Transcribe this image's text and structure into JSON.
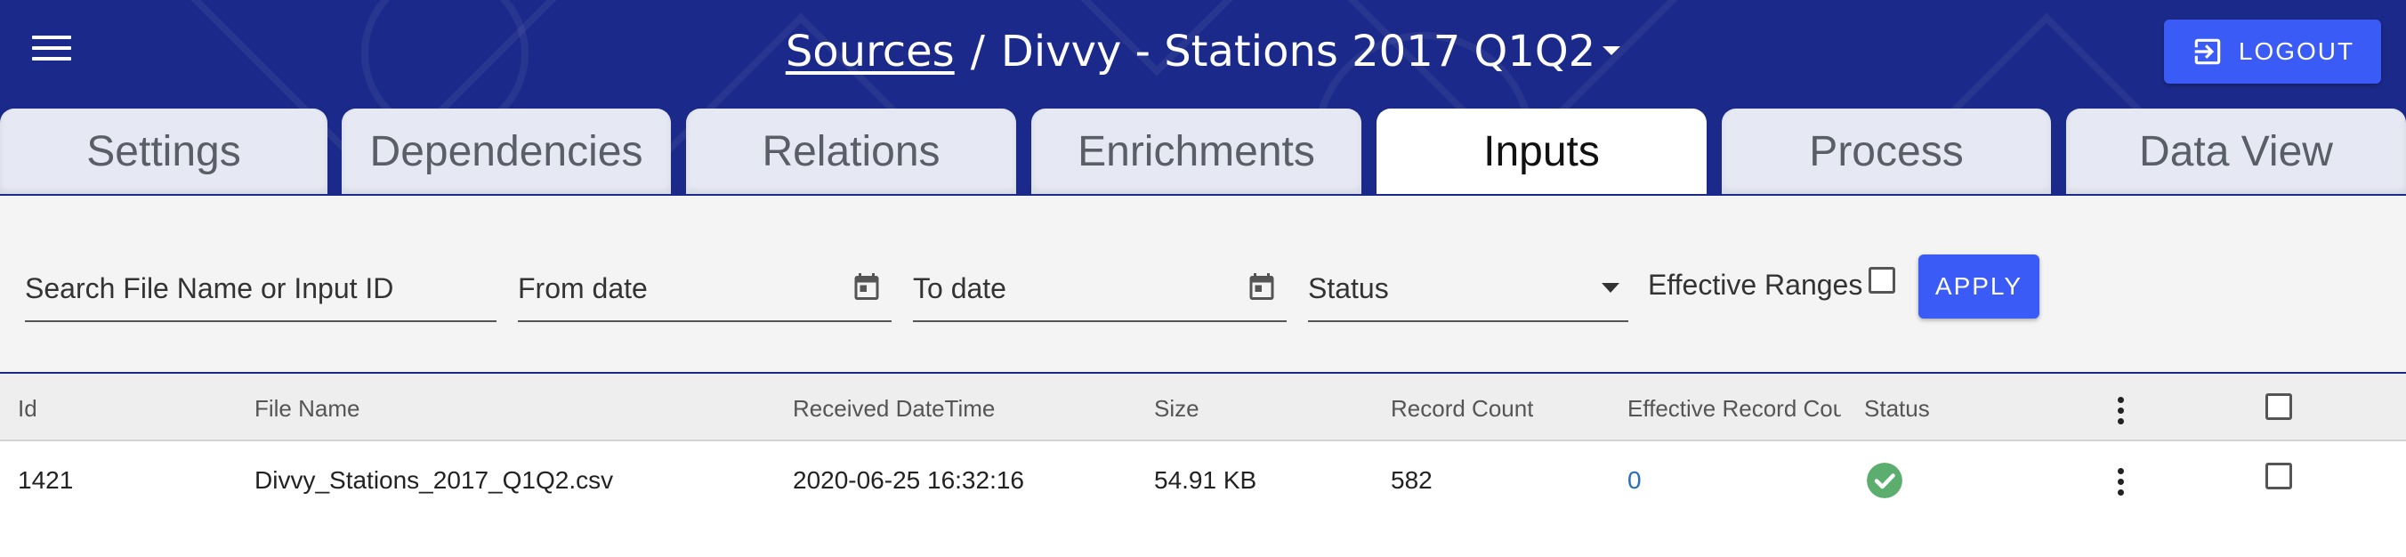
{
  "header": {
    "breadcrumb_link": "Sources",
    "breadcrumb_sep": "/",
    "source_name": "Divvy - Stations 2017 Q1Q2",
    "logout_label": "LOGOUT",
    "colors": {
      "header_bg": "#1b2a8a",
      "accent": "#3a5bf5"
    }
  },
  "tabs": [
    {
      "label": "Settings"
    },
    {
      "label": "Dependencies"
    },
    {
      "label": "Relations"
    },
    {
      "label": "Enrichments"
    },
    {
      "label": "Inputs",
      "active": true
    },
    {
      "label": "Process"
    },
    {
      "label": "Data View"
    }
  ],
  "filters": {
    "search_placeholder": "Search File Name or Input ID",
    "from_date_placeholder": "From date",
    "to_date_placeholder": "To date",
    "status_placeholder": "Status",
    "effective_ranges_label": "Effective Ranges",
    "effective_ranges_checked": false,
    "apply_label": "APPLY"
  },
  "table": {
    "columns": [
      "Id",
      "File Name",
      "Received DateTime",
      "Size",
      "Record Count",
      "Effective Record Cou",
      "Status"
    ],
    "rows": [
      {
        "id": "1421",
        "file_name": "Divvy_Stations_2017_Q1Q2.csv",
        "received": "2020-06-25 16:32:16",
        "size": "54.91 KB",
        "record_count": "582",
        "effective_record_count": "0",
        "status_icon": "check-circle-icon",
        "status_color": "#5cae6e"
      }
    ]
  }
}
